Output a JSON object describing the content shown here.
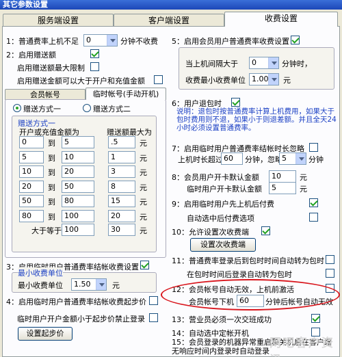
{
  "window": {
    "title": "其它参数设置"
  },
  "tabs": [
    "服务端设置",
    "客户端设置",
    "收费设置"
  ],
  "left": {
    "i1": {
      "label": "1：普通费率上机不足",
      "value": "0",
      "suffix": "分钟不收费"
    },
    "i2": "2：启用赠送额",
    "i2a": "启用赠送额最大限制",
    "i2b": "启用赠送金额可以大于开户和充值金额",
    "subtabs": [
      "会员帐号",
      "临时帐号(手动开机)"
    ],
    "r1": "赠送方式一",
    "r2": "赠送方式二",
    "r1caption": "赠送方式一",
    "col1": "开户或充值金额为",
    "col2": "赠送额最大为",
    "to": "到",
    "yuan": "元",
    "rows": [
      [
        "0",
        "5",
        ".5"
      ],
      [
        "5",
        "10",
        "1"
      ],
      [
        "10",
        "20",
        "3"
      ],
      [
        "20",
        "50",
        "8"
      ],
      [
        "50",
        "80",
        "15"
      ],
      [
        "80",
        "100",
        "20"
      ]
    ],
    "last": {
      "label": "大于等于",
      "v1": "100",
      "v2": "30"
    },
    "i3": "3：启用临时用户普通费率结帐收费设置",
    "i3cap": "最小收费单位",
    "i3label": "最小收费单位",
    "i3value": "1.50",
    "i3unit": "元",
    "i4": "4：启用临时用户普通费率结帐收费起步价",
    "i4a": "临时用户开户金额小于起步价禁止登录",
    "btn_start": "设置起步价"
  },
  "right": {
    "i5": "5：启用会员用户普通费率收费设置",
    "i5a": "当上机间隔大于",
    "i5av": "0",
    "i5aunit": "分钟时，",
    "i5b": "收费最小收费单位",
    "i5bv": "1.00",
    "i5bunit": "元",
    "i6": "6：用户退包时",
    "i6note": "说明：退包时按普通费率计算上机费用，如果大于包时费用则不退，如果小于则退差额。并且全天24小时必须设置普通费率。",
    "i7": "7：启用临时用户普通费率结帐时长忽略",
    "i7a": "上机时长超过",
    "i7av": "60",
    "i7b": "分钟，忽略",
    "i7bv": "5",
    "i7c": "分钟",
    "i8": "8：会员用户开卡默认金额",
    "i8v": "10",
    "i8unit": "元",
    "i8a": "临时用户开卡默认金额",
    "i8av": "5",
    "i8aunit": "元",
    "i9": "9：启用临时用户先上机后付费",
    "i9a": "自动选中后付费选项",
    "i10": "10：允许设置次收费端",
    "btn_sub": "设置次收费端",
    "i11": "11：普通费率登录后到包时时间自动转为包时",
    "i11a": "在包时时间后登录自动转为包时",
    "i12": "12：会员帐号自动无效，上机前激活",
    "i12a": "会员帐号下机",
    "i12av": "60",
    "i12b": "分钟后帐号自动无效",
    "i13": "13：营业员必须一次交班成功",
    "i14": "14：自动选中定帐开机",
    "i15": "15：会员登录的机器异常重启和关机后在客户端无响应时间内登录时自动登录"
  },
  "watermark": "网吧客户资讯",
  "colors": {
    "accent": "#1a3fc4",
    "highlight": "#d9161d",
    "check": "#21a121"
  }
}
